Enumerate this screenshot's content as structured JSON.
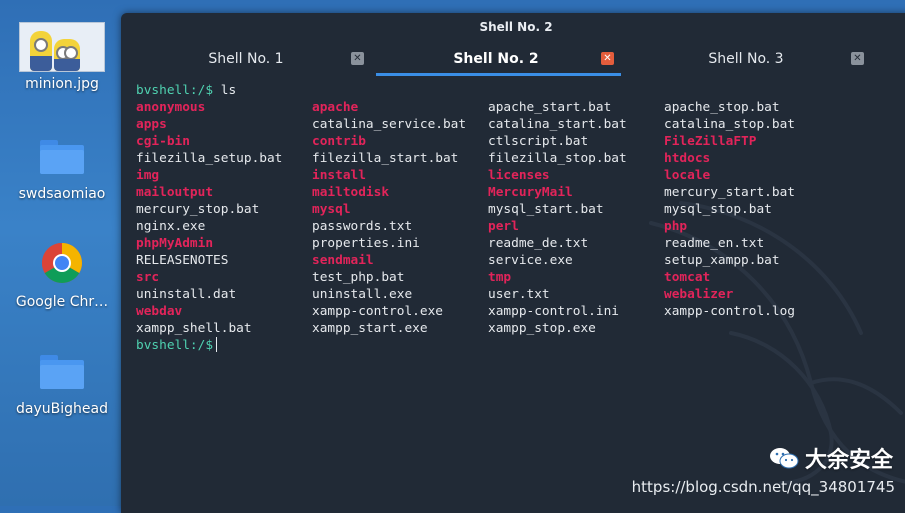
{
  "desktop": {
    "icons": [
      {
        "label": "minion.jpg",
        "type": "image"
      },
      {
        "label": "swdsaomiao",
        "type": "folder"
      },
      {
        "label": "Google Chr…",
        "type": "chrome"
      },
      {
        "label": "dayuBighead",
        "type": "folder"
      }
    ]
  },
  "window": {
    "title": "Shell No. 2",
    "tabs": [
      {
        "label": "Shell No. 1",
        "active": false
      },
      {
        "label": "Shell No. 2",
        "active": true
      },
      {
        "label": "Shell No. 3",
        "active": false
      }
    ],
    "close_glyph": "✕"
  },
  "terminal": {
    "prompt": "bvshell:/$",
    "command": "ls",
    "listing_columns": 4,
    "entries": [
      {
        "name": "anonymous",
        "kind": "dir"
      },
      {
        "name": "apache",
        "kind": "dir"
      },
      {
        "name": "apache_start.bat",
        "kind": "file"
      },
      {
        "name": "apache_stop.bat",
        "kind": "file"
      },
      {
        "name": "apps",
        "kind": "dir"
      },
      {
        "name": "catalina_service.bat",
        "kind": "file"
      },
      {
        "name": "catalina_start.bat",
        "kind": "file"
      },
      {
        "name": "catalina_stop.bat",
        "kind": "file"
      },
      {
        "name": "cgi-bin",
        "kind": "dir"
      },
      {
        "name": "contrib",
        "kind": "dir"
      },
      {
        "name": "ctlscript.bat",
        "kind": "file"
      },
      {
        "name": "FileZillaFTP",
        "kind": "dir"
      },
      {
        "name": "filezilla_setup.bat",
        "kind": "file"
      },
      {
        "name": "filezilla_start.bat",
        "kind": "file"
      },
      {
        "name": "filezilla_stop.bat",
        "kind": "file"
      },
      {
        "name": "htdocs",
        "kind": "dir"
      },
      {
        "name": "img",
        "kind": "dir"
      },
      {
        "name": "install",
        "kind": "dir"
      },
      {
        "name": "licenses",
        "kind": "dir"
      },
      {
        "name": "locale",
        "kind": "dir"
      },
      {
        "name": "mailoutput",
        "kind": "dir"
      },
      {
        "name": "mailtodisk",
        "kind": "dir"
      },
      {
        "name": "MercuryMail",
        "kind": "dir"
      },
      {
        "name": "mercury_start.bat",
        "kind": "file"
      },
      {
        "name": "mercury_stop.bat",
        "kind": "file"
      },
      {
        "name": "mysql",
        "kind": "dir"
      },
      {
        "name": "mysql_start.bat",
        "kind": "file"
      },
      {
        "name": "mysql_stop.bat",
        "kind": "file"
      },
      {
        "name": "nginx.exe",
        "kind": "file"
      },
      {
        "name": "passwords.txt",
        "kind": "file"
      },
      {
        "name": "perl",
        "kind": "dir"
      },
      {
        "name": "php",
        "kind": "dir"
      },
      {
        "name": "phpMyAdmin",
        "kind": "dir"
      },
      {
        "name": "properties.ini",
        "kind": "file"
      },
      {
        "name": "readme_de.txt",
        "kind": "file"
      },
      {
        "name": "readme_en.txt",
        "kind": "file"
      },
      {
        "name": "RELEASENOTES",
        "kind": "file"
      },
      {
        "name": "sendmail",
        "kind": "dir"
      },
      {
        "name": "service.exe",
        "kind": "file"
      },
      {
        "name": "setup_xampp.bat",
        "kind": "file"
      },
      {
        "name": "src",
        "kind": "dir"
      },
      {
        "name": "test_php.bat",
        "kind": "file"
      },
      {
        "name": "tmp",
        "kind": "dir"
      },
      {
        "name": "tomcat",
        "kind": "dir"
      },
      {
        "name": "uninstall.dat",
        "kind": "file"
      },
      {
        "name": "uninstall.exe",
        "kind": "file"
      },
      {
        "name": "user.txt",
        "kind": "file"
      },
      {
        "name": "webalizer",
        "kind": "dir"
      },
      {
        "name": "webdav",
        "kind": "dir"
      },
      {
        "name": "xampp-control.exe",
        "kind": "file"
      },
      {
        "name": "xampp-control.ini",
        "kind": "file"
      },
      {
        "name": "xampp-control.log",
        "kind": "file"
      },
      {
        "name": "xampp_shell.bat",
        "kind": "file"
      },
      {
        "name": "xampp_start.exe",
        "kind": "file"
      },
      {
        "name": "xampp_stop.exe",
        "kind": "file"
      }
    ]
  },
  "overlay": {
    "watermark_text": "大余安全",
    "url_text": "https://blog.csdn.net/qq_34801745"
  },
  "colors": {
    "terminal_bg": "#212a36",
    "prompt": "#4fd1b0",
    "dir": "#e2245a",
    "file": "#e6e9ed",
    "active_tab_underline": "#3a8ee6",
    "active_close": "#e45d3c"
  }
}
